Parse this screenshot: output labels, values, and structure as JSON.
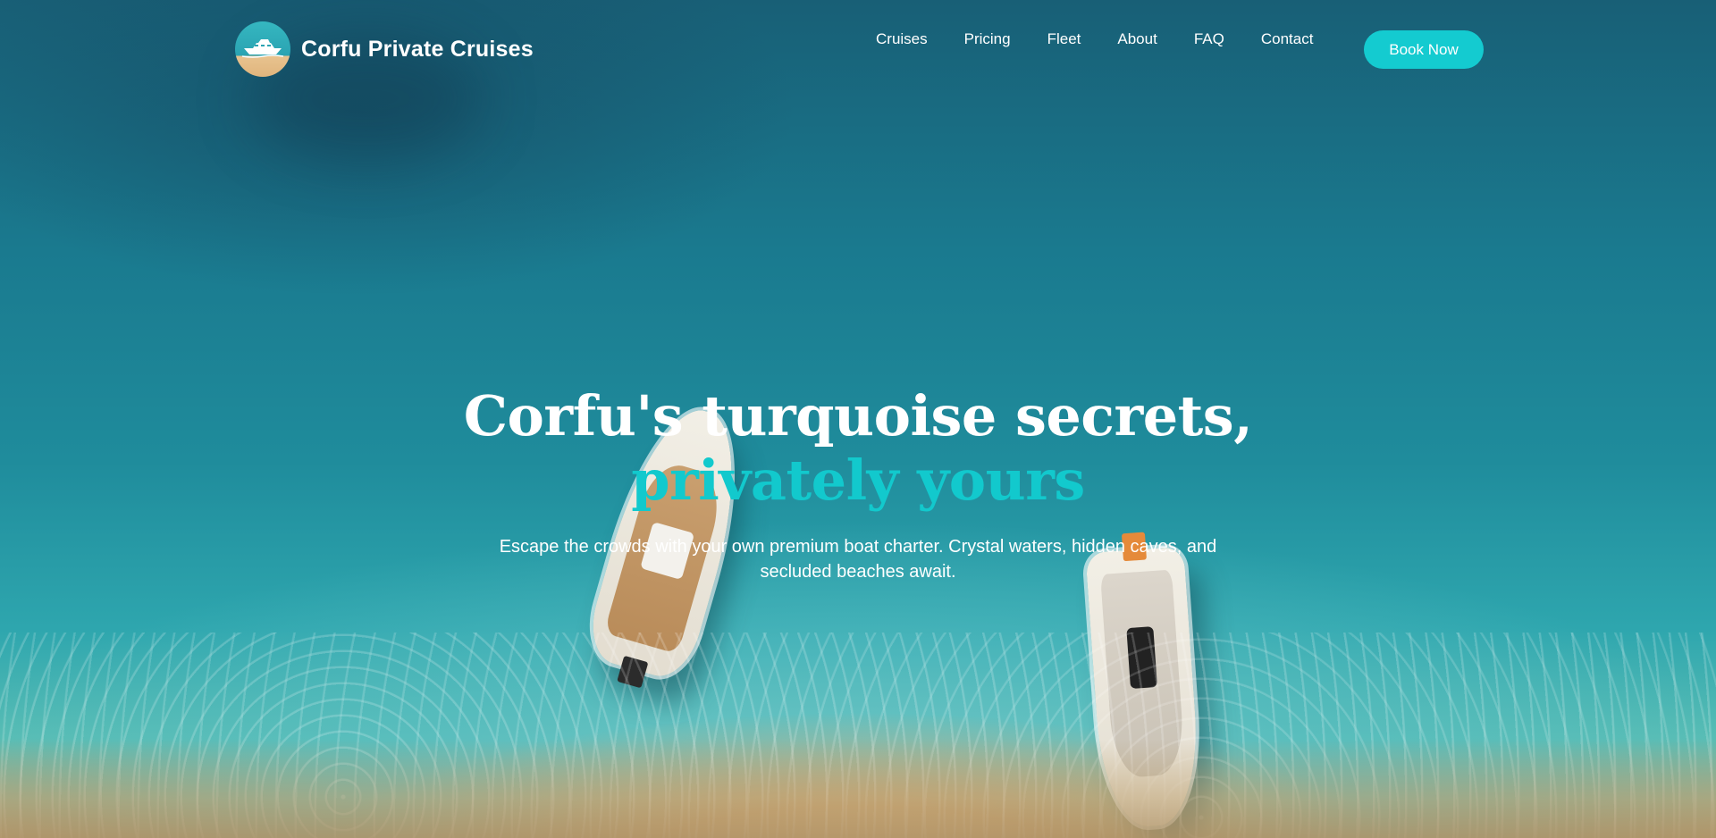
{
  "brand": {
    "name": "Corfu Private Cruises",
    "logo_icon": "yacht-logo-icon"
  },
  "nav": {
    "items": [
      {
        "label": "Cruises"
      },
      {
        "label": "Pricing"
      },
      {
        "label": "Fleet"
      },
      {
        "label": "About"
      },
      {
        "label": "FAQ"
      },
      {
        "label": "Contact"
      }
    ],
    "cta_label": "Book Now"
  },
  "hero": {
    "title_line1": "Corfu's turquoise secrets,",
    "title_line2": "privately yours",
    "subtitle": "Escape the crowds with your own premium boat charter. Crystal waters, hidden caves, and secluded beaches await."
  },
  "colors": {
    "accent": "#14cbd0",
    "highlight_text": "#12c9cd",
    "text": "#ffffff"
  }
}
